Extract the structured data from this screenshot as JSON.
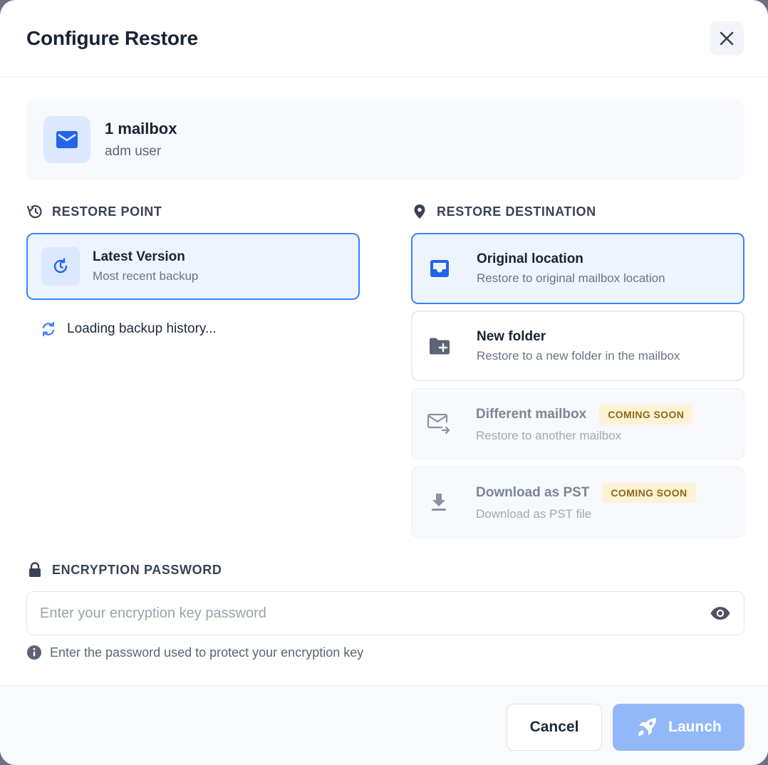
{
  "dialog": {
    "title": "Configure Restore"
  },
  "summary": {
    "title": "1 mailbox",
    "subtitle": "adm user",
    "icon": "mail-icon"
  },
  "restore_point": {
    "label": "RESTORE POINT",
    "option": {
      "title": "Latest Version",
      "subtitle": "Most recent backup"
    },
    "loading_text": "Loading backup history..."
  },
  "restore_destination": {
    "label": "RESTORE DESTINATION",
    "options": [
      {
        "title": "Original location",
        "subtitle": "Restore to original mailbox location",
        "state": "selected",
        "icon": "inbox-icon"
      },
      {
        "title": "New folder",
        "subtitle": "Restore to a new folder in the mailbox",
        "state": "available",
        "icon": "folder-plus-icon"
      },
      {
        "title": "Different mailbox",
        "subtitle": "Restore to another mailbox",
        "state": "disabled",
        "badge": "COMING SOON",
        "icon": "mail-forward-icon"
      },
      {
        "title": "Download as PST",
        "subtitle": "Download as PST file",
        "state": "disabled",
        "badge": "COMING SOON",
        "icon": "download-icon"
      }
    ]
  },
  "encryption": {
    "label": "ENCRYPTION PASSWORD",
    "placeholder": "Enter your encryption key password",
    "value": "",
    "hint": "Enter the password used to protect your encryption key"
  },
  "footer": {
    "cancel_label": "Cancel",
    "launch_label": "Launch"
  },
  "colors": {
    "accent": "#3b82f6",
    "launch_disabled": "#93b8f8",
    "badge_bg": "#fdf2d5"
  }
}
